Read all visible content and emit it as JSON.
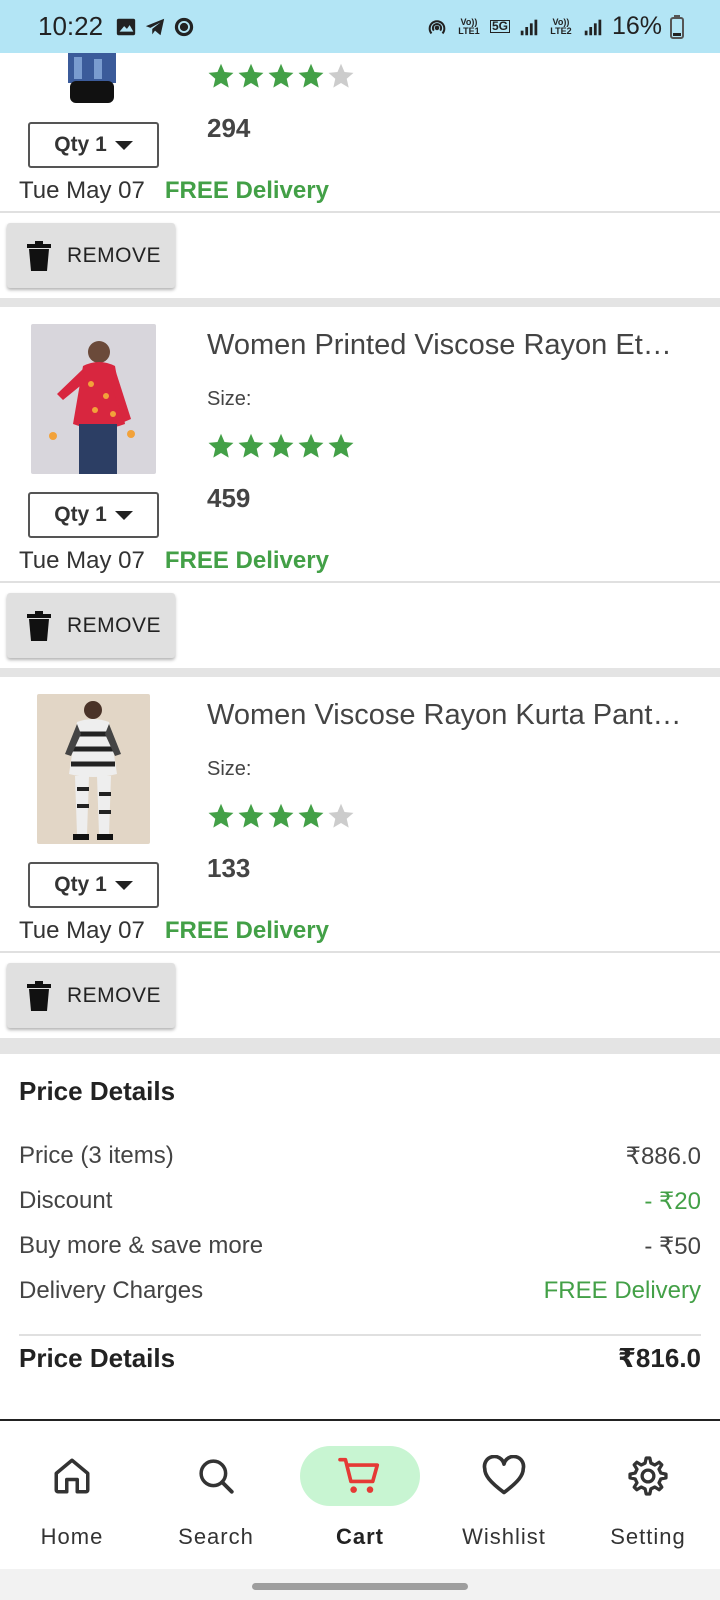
{
  "status_bar": {
    "time": "10:22",
    "battery": "16%",
    "sim1": "Vo)) LTE1",
    "sim2": "Vo)) LTE2",
    "network": "5G"
  },
  "items": [
    {
      "rating": 4,
      "price": "294",
      "qty_label": "Qty 1",
      "delivery_date": "Tue May 07",
      "delivery_text": "FREE Delivery",
      "remove_label": "REMOVE"
    },
    {
      "title": "Women Printed Viscose Rayon Ethnic Top",
      "size_label": "Size:",
      "rating": 5,
      "price": "459",
      "qty_label": "Qty 1",
      "delivery_date": "Tue May 07",
      "delivery_text": "FREE Delivery",
      "remove_label": "REMOVE"
    },
    {
      "title": "Women Viscose Rayon Kurta Pant Set",
      "size_label": "Size:",
      "rating": 4,
      "price": "133",
      "qty_label": "Qty 1",
      "delivery_date": "Tue May 07",
      "delivery_text": "FREE Delivery",
      "remove_label": "REMOVE"
    }
  ],
  "price_details": {
    "heading": "Price Details",
    "rows": [
      {
        "label": "Price (3 items)",
        "value": "₹886.0"
      },
      {
        "label": "Discount",
        "value": "- ₹20"
      },
      {
        "label": "Buy more & save more",
        "value": "- ₹50"
      },
      {
        "label": "Delivery Charges",
        "value": "FREE Delivery"
      }
    ],
    "total_label": "Price Details",
    "total_value": "₹816.0"
  },
  "bottom_nav": [
    {
      "label": "Home",
      "icon": "home-icon"
    },
    {
      "label": "Search",
      "icon": "search-icon"
    },
    {
      "label": "Cart",
      "icon": "cart-icon",
      "active": true
    },
    {
      "label": "Wishlist",
      "icon": "heart-icon"
    },
    {
      "label": "Setting",
      "icon": "gear-icon"
    }
  ],
  "colors": {
    "status_bar_bg": "#b3e5f5",
    "accent_green": "#43a047",
    "star_inactive": "#cccccc",
    "active_nav_bg": "#c8f5d2",
    "cart_red": "#e53935"
  }
}
